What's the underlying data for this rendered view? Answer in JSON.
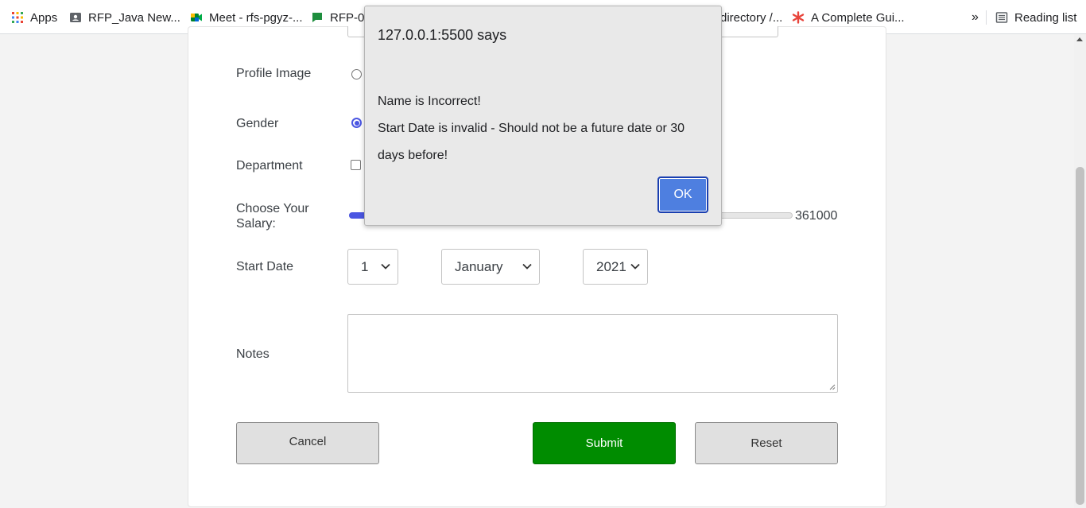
{
  "bookmarks": {
    "apps": "Apps",
    "items": [
      "RFP_Java New...",
      "Meet - rfs-pgyz-...",
      "RFP-0",
      "directory /...",
      "A Complete Gui..."
    ],
    "more": "»",
    "reading_list": "Reading list"
  },
  "form": {
    "profile_image_label": "Profile Image",
    "gender_label": "Gender",
    "department_label": "Department",
    "salary_label": "Choose Your Salary:",
    "salary_value": "361000",
    "salary_fraction": 0.35,
    "start_date_label": "Start Date",
    "day_value": "1",
    "month_value": "January",
    "year_value": "2021",
    "notes_label": "Notes",
    "notes_value": "",
    "cancel_label": "Cancel",
    "submit_label": "Submit",
    "reset_label": "Reset"
  },
  "dialog": {
    "title": "127.0.0.1:5500 says",
    "line1": "Name is Incorrect!",
    "line2": "Start Date is invalid - Should not be a future date or 30 days before!",
    "ok_label": "OK"
  },
  "colors": {
    "accent": "#4a56e2",
    "submit_green": "#008c00",
    "ok_blue": "#4e7fe0"
  }
}
